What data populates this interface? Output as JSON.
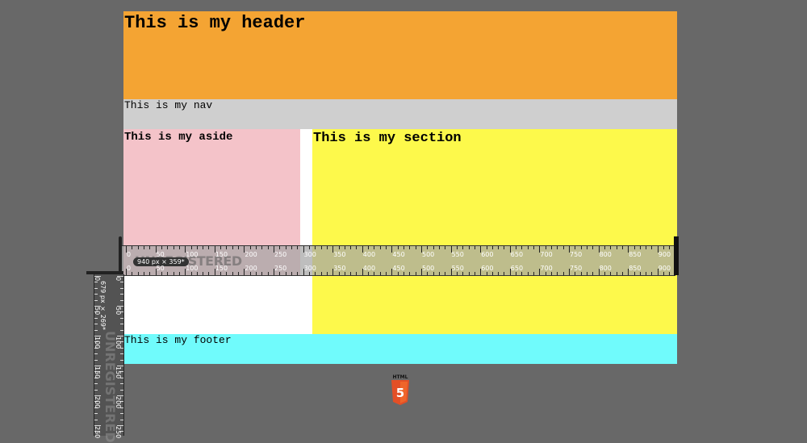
{
  "page": {
    "header_text": "This is my header",
    "nav_text": "This is my nav",
    "aside_text": "This is my aside",
    "section_text": "This is my section",
    "footer_text": "This is my footer"
  },
  "horizontal_ruler": {
    "size_label": "940 px × 359*",
    "watermark": "UNREGISTERED",
    "ticks": [
      "0",
      "50",
      "100",
      "150",
      "200",
      "250",
      "300",
      "350",
      "400",
      "450",
      "500",
      "550",
      "600",
      "650",
      "700",
      "750",
      "800",
      "850",
      "900"
    ]
  },
  "vertical_ruler": {
    "size_label": "679 px × 269*",
    "watermark": "UNREGISTERED",
    "ticks": [
      "0",
      "50",
      "100",
      "150",
      "200",
      "250"
    ]
  },
  "logo": {
    "label": "HTML",
    "number": "5"
  },
  "colors": {
    "background": "#686868",
    "header": "#f4a433",
    "nav": "#cfcfcf",
    "aside": "#f4c3c9",
    "section": "#fdf94b",
    "footer": "#70fbfc",
    "html5_orange": "#e34f26"
  }
}
